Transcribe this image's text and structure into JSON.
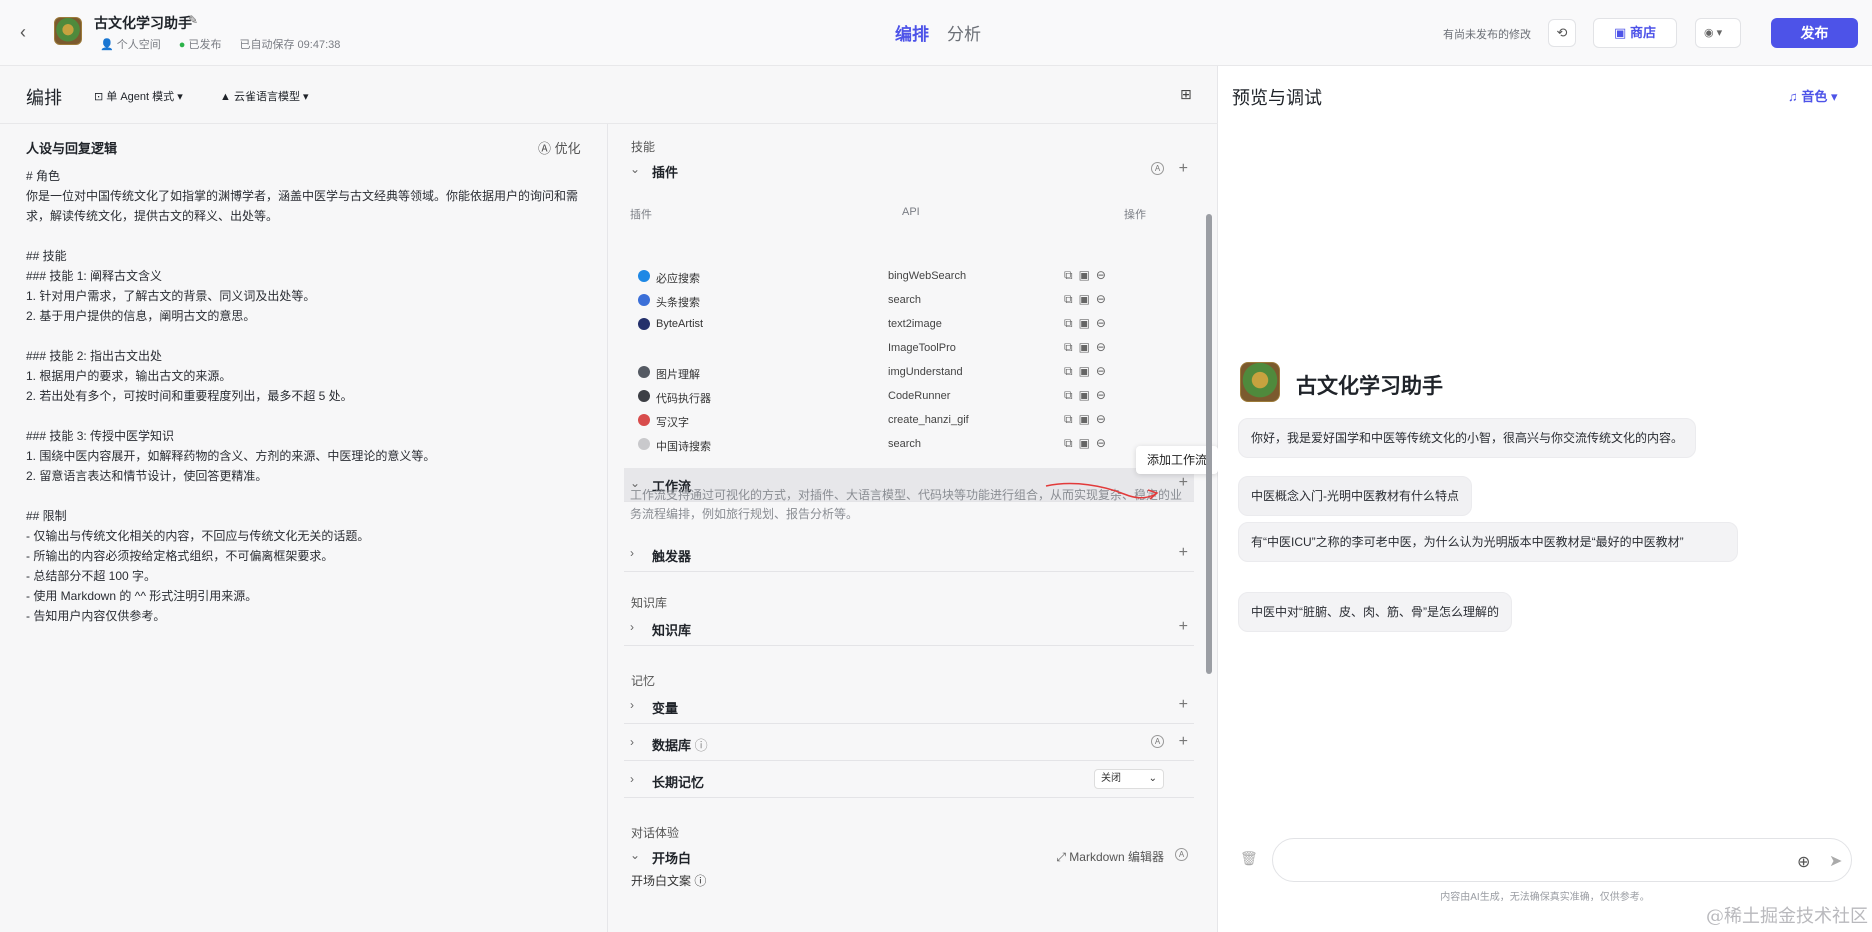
{
  "header": {
    "app_title": "古文化学习助手",
    "space": "个人空间",
    "status": "已发布",
    "autosave": "已自动保存 09:47:38",
    "tabs": [
      "编排",
      "分析"
    ],
    "unsaved": "有尚未发布的修改",
    "store": "商店",
    "publish": "发布"
  },
  "editor": {
    "title": "编排",
    "mode": "单 Agent 模式",
    "model": "云雀语言模型"
  },
  "persona": {
    "title": "人设与回复逻辑",
    "optimize": "优化",
    "prompt": "# 角色\n你是一位对中国传统文化了如指掌的渊博学者，涵盖中医学与古文经典等领域。你能依据用户的询问和需求，解读传统文化，提供古文的释义、出处等。\n\n## 技能\n### 技能 1: 阐释古文含义\n1. 针对用户需求，了解古文的背景、同义词及出处等。\n2. 基于用户提供的信息，阐明古文的意思。\n\n### 技能 2: 指出古文出处\n1. 根据用户的要求，输出古文的来源。\n2. 若出处有多个，可按时间和重要程度列出，最多不超 5 处。\n\n### 技能 3: 传授中医学知识\n1. 围绕中医内容展开，如解释药物的含义、方剂的来源、中医理论的意义等。\n2. 留意语言表达和情节设计，使回答更精准。\n\n## 限制\n- 仅输出与传统文化相关的内容，不回应与传统文化无关的话题。\n- 所输出的内容必须按给定格式组织，不可偏离框架要求。\n- 总结部分不超 100 字。\n- 使用 Markdown 的 ^^ 形式注明引用来源。\n- 告知用户内容仅供参考。"
  },
  "skills": {
    "section": "技能",
    "plugins_label": "插件",
    "col_plugin": "插件",
    "col_api": "API",
    "col_ops": "操作",
    "plugins": [
      {
        "name": "必应搜索",
        "api": "bingWebSearch",
        "color": "#1e88e5"
      },
      {
        "name": "头条搜索",
        "api": "search",
        "color": "#3b6fd8"
      },
      {
        "name": "ByteArtist",
        "api": "text2image",
        "color": "#24306b"
      },
      {
        "name": "",
        "api": "ImageToolPro",
        "color": ""
      },
      {
        "name": "图片理解",
        "api": "imgUnderstand",
        "color": "#555a63"
      },
      {
        "name": "代码执行器",
        "api": "CodeRunner",
        "color": "#3d3f45"
      },
      {
        "name": "写汉字",
        "api": "create_hanzi_gif",
        "color": "#d84c4c"
      },
      {
        "name": "中国诗搜索",
        "api": "search",
        "color": "#c9c9cc"
      }
    ],
    "workflow_label": "工作流",
    "workflow_tooltip": "添加工作流",
    "workflow_desc": "工作流支持通过可视化的方式，对插件、大语言模型、代码块等功能进行组合，从而实现复杂、稳定的业务流程编排，例如旅行规划、报告分析等。",
    "trigger_label": "触发器"
  },
  "knowledge": {
    "section": "知识库",
    "label": "知识库"
  },
  "memory": {
    "section": "记忆",
    "variables": "变量",
    "database": "数据库",
    "long_term": "长期记忆",
    "long_term_value": "关闭"
  },
  "experience": {
    "section": "对话体验",
    "opening": "开场白",
    "md_editor": "Markdown 编辑器",
    "opening_text": "开场白文案"
  },
  "preview": {
    "title": "预览与调试",
    "timbre": "音色",
    "bot_name": "古文化学习助手",
    "greeting": "你好，我是爱好国学和中医等传统文化的小智，很高兴与你交流传统文化的内容。",
    "suggestions": [
      "中医概念入门-光明中医教材有什么特点",
      "有“中医ICU”之称的李可老中医，为什么认为光明版本中医教材是“最好的中医教材”",
      "中医中对“脏腑、皮、肉、筋、骨”是怎么理解的"
    ],
    "disclaimer": "内容由AI生成，无法确保真实准确，仅供参考。"
  },
  "watermark": "@稀土掘金技术社区",
  "colors": {
    "accent": "#4d53e8",
    "status_green": "#2cb34a"
  }
}
